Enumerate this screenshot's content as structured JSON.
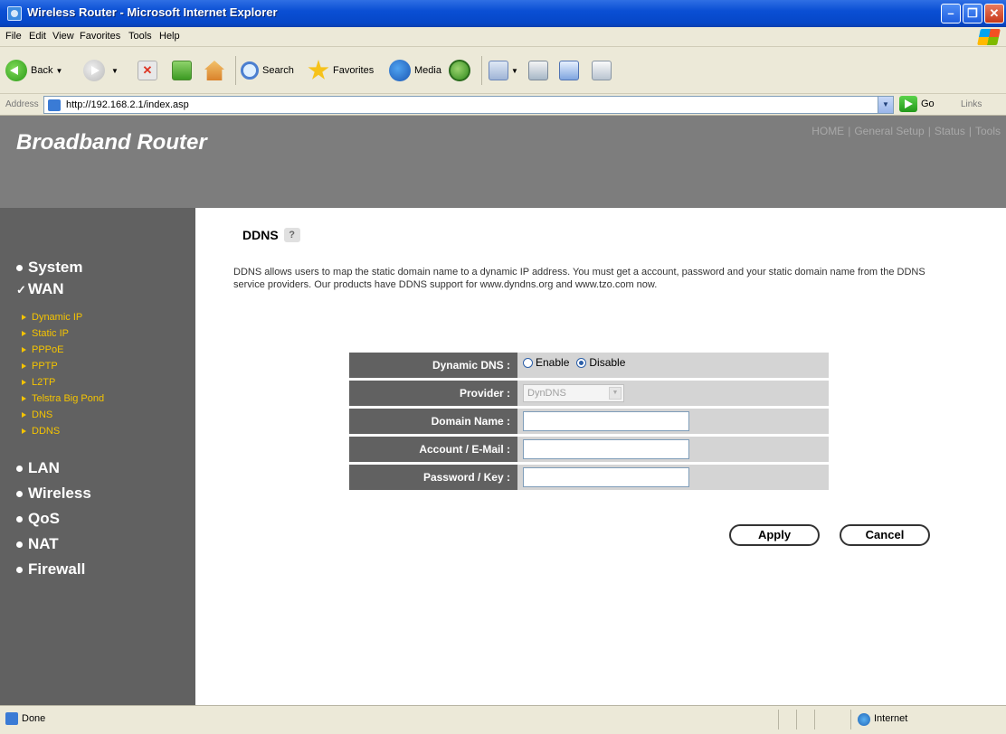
{
  "window": {
    "title": "Wireless Router - Microsoft Internet Explorer",
    "minimize": "–",
    "maximize": "❐",
    "close": "✕"
  },
  "menu": [
    "File",
    "Edit",
    "View",
    "Favorites",
    "Tools",
    "Help"
  ],
  "toolbar": {
    "back": "Back",
    "search": "Search",
    "favorites": "Favorites",
    "media": "Media"
  },
  "address": {
    "label": "Address",
    "url": "http://192.168.2.1/index.asp",
    "go": "Go",
    "links": "Links"
  },
  "header": {
    "brand": "Broadband Router",
    "nav": [
      "HOME",
      "General Setup",
      "Status",
      "Tools"
    ]
  },
  "sidebar": {
    "main": [
      "System",
      "WAN",
      "LAN",
      "Wireless",
      "QoS",
      "NAT",
      "Firewall"
    ],
    "wan_sub": [
      "Dynamic IP",
      "Static IP",
      "PPPoE",
      "PPTP",
      "L2TP",
      "Telstra Big Pond",
      "DNS",
      "DDNS"
    ]
  },
  "content": {
    "heading": "DDNS",
    "help": "?",
    "description": "DDNS allows users to map the static domain name to a dynamic IP address. You must get a account, password and your static domain name from the DDNS service providers. Our products have DDNS support for www.dyndns.org and www.tzo.com now."
  },
  "form": {
    "dynamic_dns_label": "Dynamic DNS :",
    "enable": "Enable",
    "disable": "Disable",
    "selected": "Disable",
    "provider_label": "Provider :",
    "provider_value": "DynDNS",
    "domain_label": "Domain Name :",
    "account_label": "Account / E-Mail :",
    "password_label": "Password / Key :",
    "apply": "Apply",
    "cancel": "Cancel"
  },
  "status": {
    "text": "Done",
    "zone": "Internet"
  }
}
